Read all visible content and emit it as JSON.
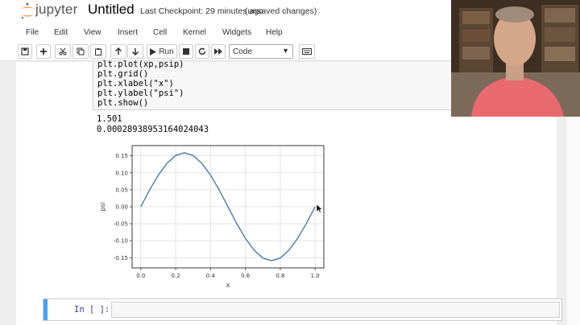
{
  "header": {
    "logo_text": "jupyter",
    "notebook_title": "Untitled",
    "checkpoint": "Last Checkpoint: 29 minutes ago",
    "status": "(unsaved changes)"
  },
  "menu": [
    "File",
    "Edit",
    "View",
    "Insert",
    "Cell",
    "Kernel",
    "Widgets",
    "Help"
  ],
  "toolbar": {
    "run_label": "Run",
    "cell_type": "Code",
    "icons": [
      "save-icon",
      "add-cell-icon",
      "cut-icon",
      "copy-icon",
      "paste-icon",
      "move-up-icon",
      "move-down-icon",
      "run-icon",
      "stop-icon",
      "restart-icon",
      "fast-forward-icon",
      "keyboard-icon"
    ]
  },
  "cell": {
    "code_lines": [
      "plt.plot(xp,psip)",
      "plt.grid()",
      "plt.xlabel(\"x\")",
      "plt.ylabel(\"psi\")",
      "plt.show()"
    ],
    "output_lines": [
      "1.501",
      "0.00028938953164024043"
    ]
  },
  "new_cell": {
    "prompt": "In [ ]:"
  },
  "chart_data": {
    "type": "line",
    "xlabel": "x",
    "ylabel": "psi",
    "xlim": [
      -0.05,
      1.05
    ],
    "ylim": [
      -0.18,
      0.18
    ],
    "xticks": [
      "0.0",
      "0.2",
      "0.4",
      "0.6",
      "0.8",
      "1.0"
    ],
    "xtick_values": [
      0.0,
      0.2,
      0.4,
      0.6,
      0.8,
      1.0
    ],
    "yticks": [
      "0.15",
      "0.10",
      "0.05",
      "0.00",
      "-0.05",
      "-0.10",
      "-0.15"
    ],
    "ytick_values": [
      0.15,
      0.1,
      0.05,
      0.0,
      -0.05,
      -0.1,
      -0.15
    ],
    "grid": true,
    "color": "#4e79a7",
    "series": [
      {
        "x": [
          0.0,
          0.05,
          0.1,
          0.15,
          0.2,
          0.25,
          0.3,
          0.35,
          0.4,
          0.45,
          0.5,
          0.55,
          0.6,
          0.65,
          0.7,
          0.75,
          0.8,
          0.85,
          0.9,
          0.95,
          1.0
        ],
        "values": [
          0.0,
          0.049,
          0.093,
          0.128,
          0.151,
          0.159,
          0.151,
          0.128,
          0.093,
          0.049,
          0.0,
          -0.049,
          -0.093,
          -0.128,
          -0.151,
          -0.159,
          -0.151,
          -0.128,
          -0.093,
          -0.049,
          0.0
        ]
      }
    ]
  }
}
